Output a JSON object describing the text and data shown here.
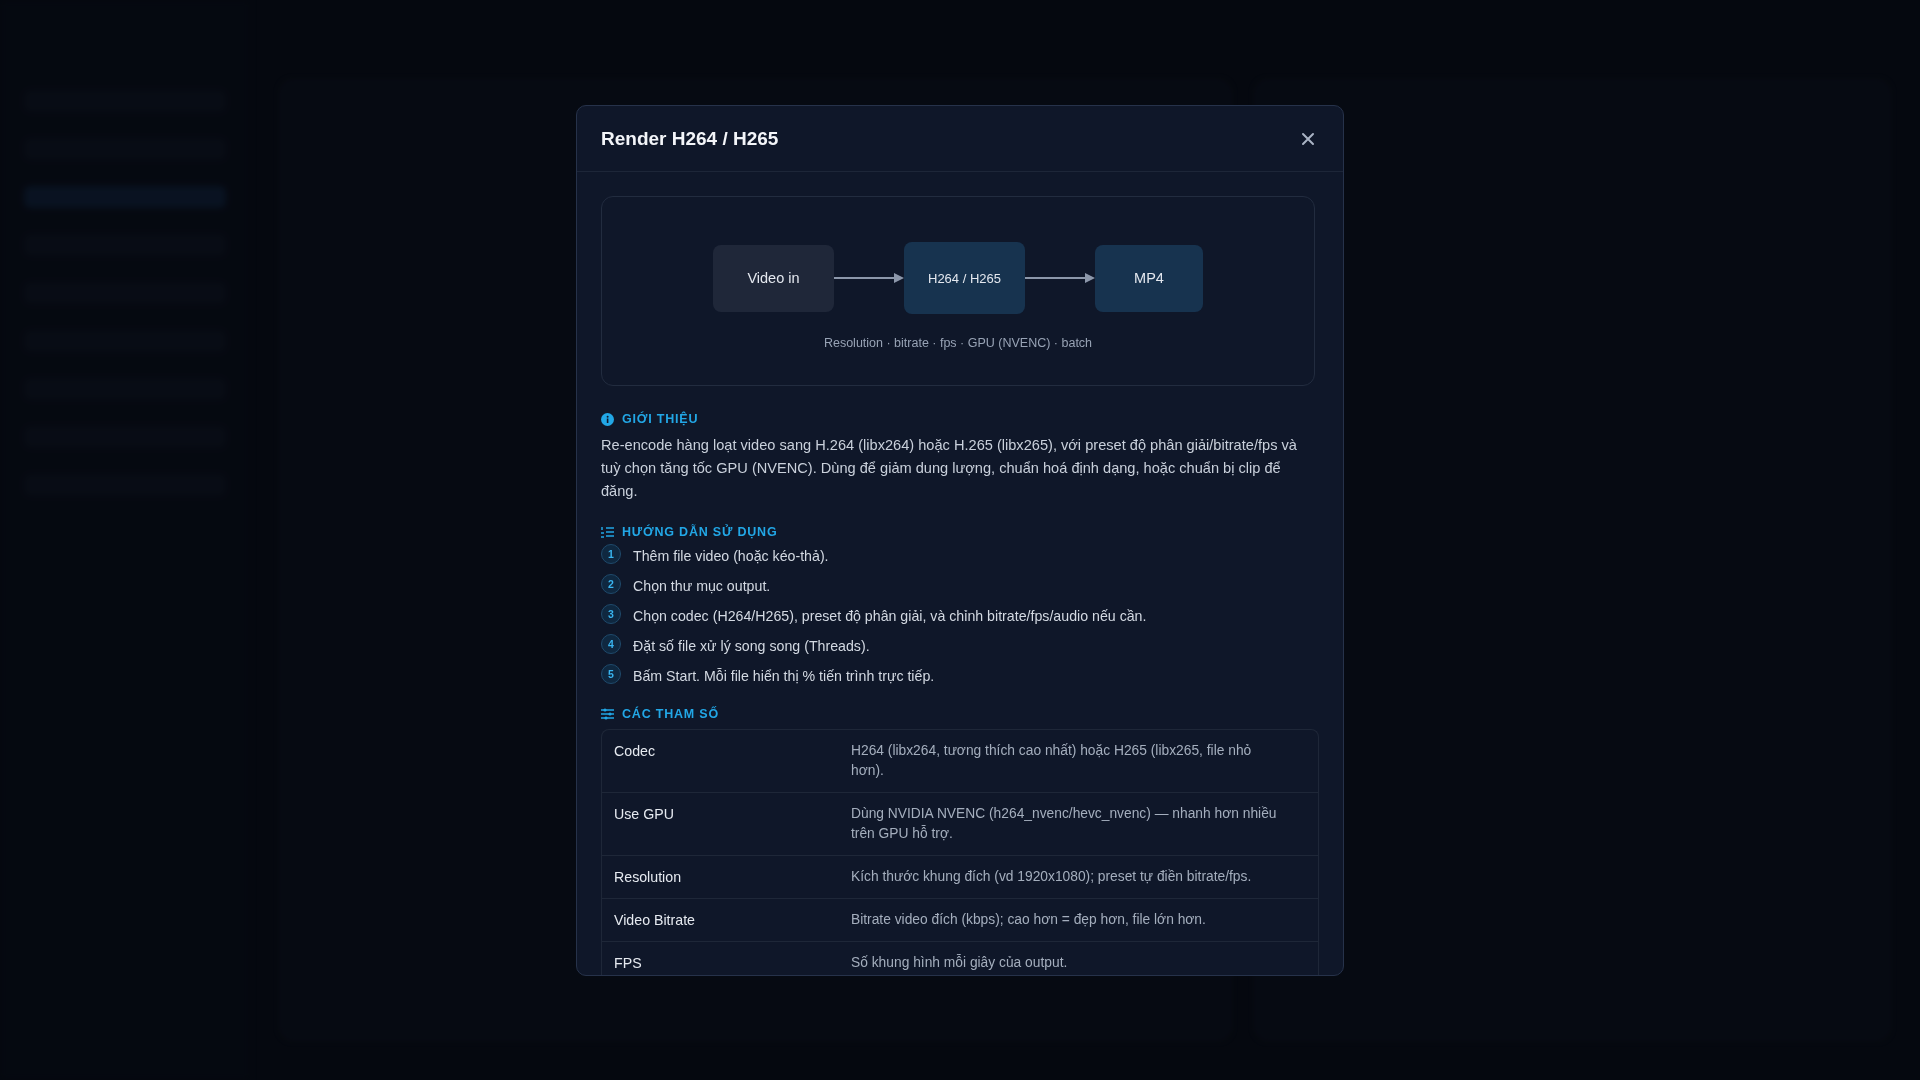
{
  "dialog": {
    "title": "Render H264 / H265",
    "diagram": {
      "nodes": [
        {
          "label": "Video in",
          "kind": "input"
        },
        {
          "label": "H264 / H265",
          "kind": "process"
        },
        {
          "label": "MP4",
          "kind": "output"
        }
      ],
      "caption": "Resolution · bitrate · fps · GPU (NVENC) · batch"
    },
    "intro": {
      "heading": "GIỚI THIỆU",
      "text": "Re-encode hàng loạt video sang H.264 (libx264) hoặc H.265 (libx265), với preset độ phân giải/bitrate/fps và tuỳ chọn tăng tốc GPU (NVENC). Dùng để giảm dung lượng, chuẩn hoá định dạng, hoặc chuẩn bị clip để đăng."
    },
    "guide": {
      "heading": "HƯỚNG DẪN SỬ DỤNG",
      "steps": [
        {
          "number": "1",
          "text": "Thêm file video (hoặc kéo-thả)."
        },
        {
          "number": "2",
          "text": "Chọn thư mục output."
        },
        {
          "number": "3",
          "text": "Chọn codec (H264/H265), preset độ phân giải, và chỉnh bitrate/fps/audio nếu cần."
        },
        {
          "number": "4",
          "text": "Đặt số file xử lý song song (Threads)."
        },
        {
          "number": "5",
          "text": "Bấm Start. Mỗi file hiển thị % tiến trình trực tiếp."
        }
      ]
    },
    "params": {
      "heading": "CÁC THAM SỐ",
      "rows": [
        {
          "name": "Codec",
          "description": "H264 (libx264, tương thích cao nhất) hoặc H265 (libx265, file nhỏ hơn)."
        },
        {
          "name": "Use GPU",
          "description": "Dùng NVIDIA NVENC (h264_nvenc/hevc_nvenc) — nhanh hơn nhiều trên GPU hỗ trợ."
        },
        {
          "name": "Resolution",
          "description": "Kích thước khung đích (vd 1920x1080); preset tự điền bitrate/fps."
        },
        {
          "name": "Video Bitrate",
          "description": "Bitrate video đích (kbps); cao hơn = đẹp hơn, file lớn hơn."
        },
        {
          "name": "FPS",
          "description": "Số khung hình mỗi giây của output."
        }
      ]
    }
  }
}
